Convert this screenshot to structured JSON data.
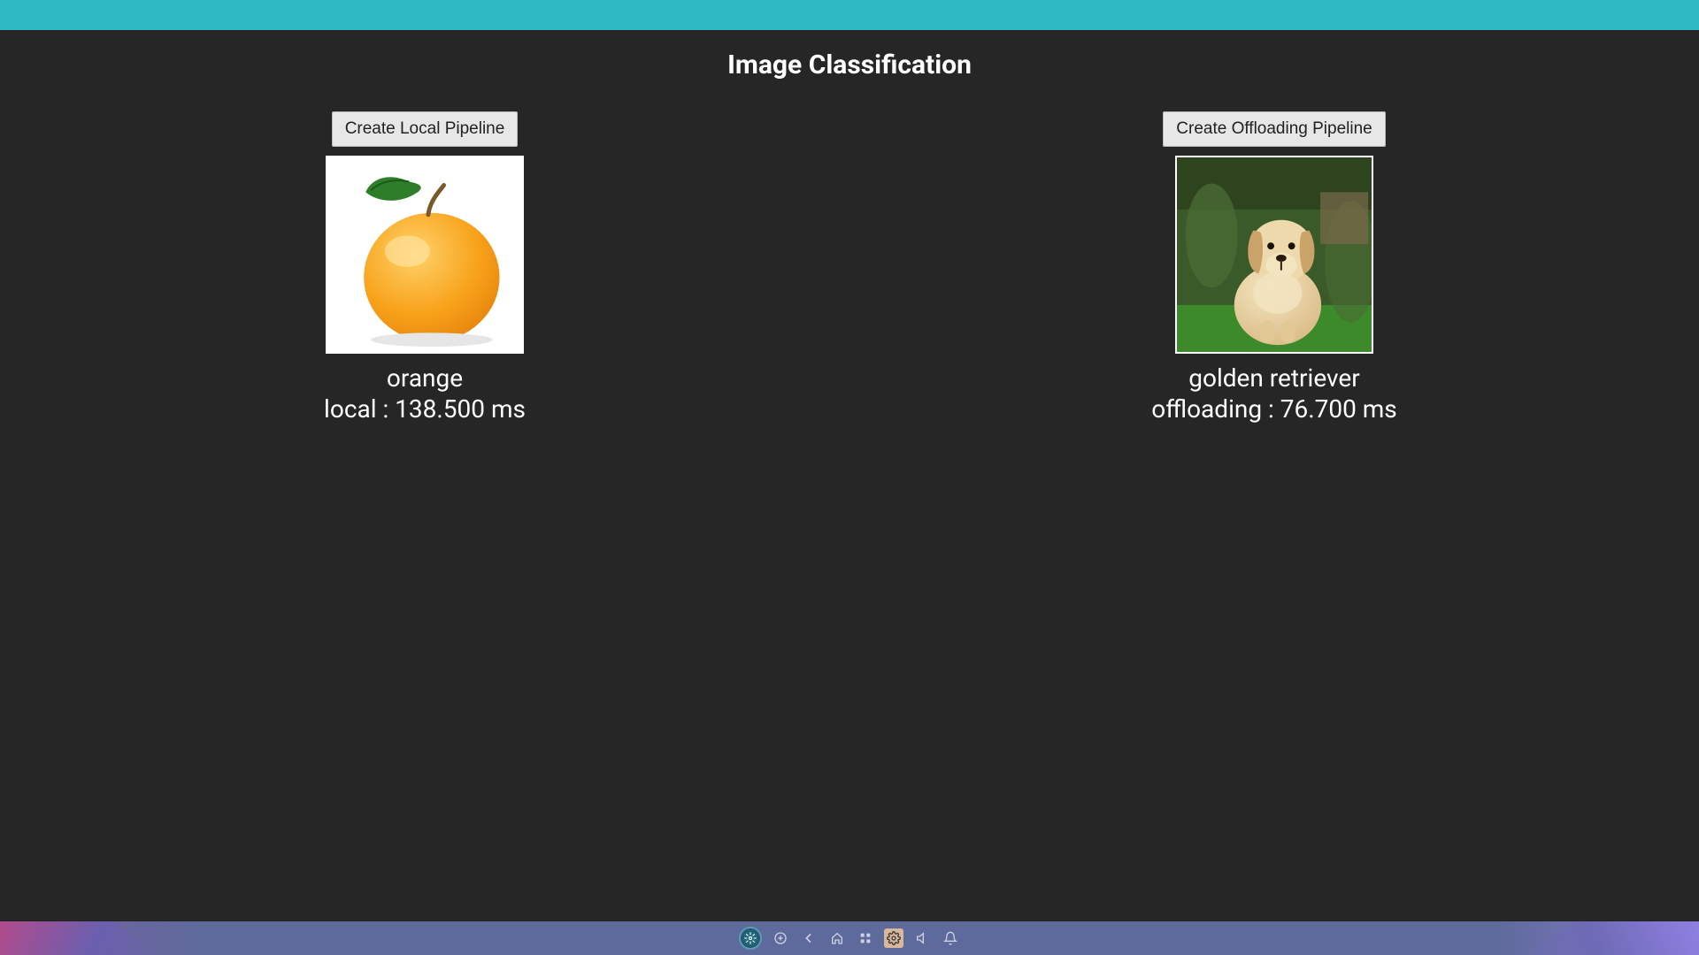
{
  "header": {
    "title": "Image Classification"
  },
  "panels": {
    "left": {
      "button_label": "Create Local Pipeline",
      "image_alt": "orange fruit with leaf on white background",
      "class_label": "orange",
      "timing_label": "local : 138.500 ms"
    },
    "right": {
      "button_label": "Create Offloading Pipeline",
      "image_alt": "golden retriever puppy sitting on grass",
      "class_label": "golden retriever",
      "timing_label": "offloading : 76.700 ms"
    }
  },
  "taskbar": {
    "icons": [
      "system-logo",
      "add",
      "back",
      "home",
      "apps",
      "settings",
      "volume",
      "notifications"
    ],
    "active": "settings"
  },
  "colors": {
    "topbar": "#2db8c3",
    "background": "#262626",
    "button_bg": "#e7e7e7"
  }
}
